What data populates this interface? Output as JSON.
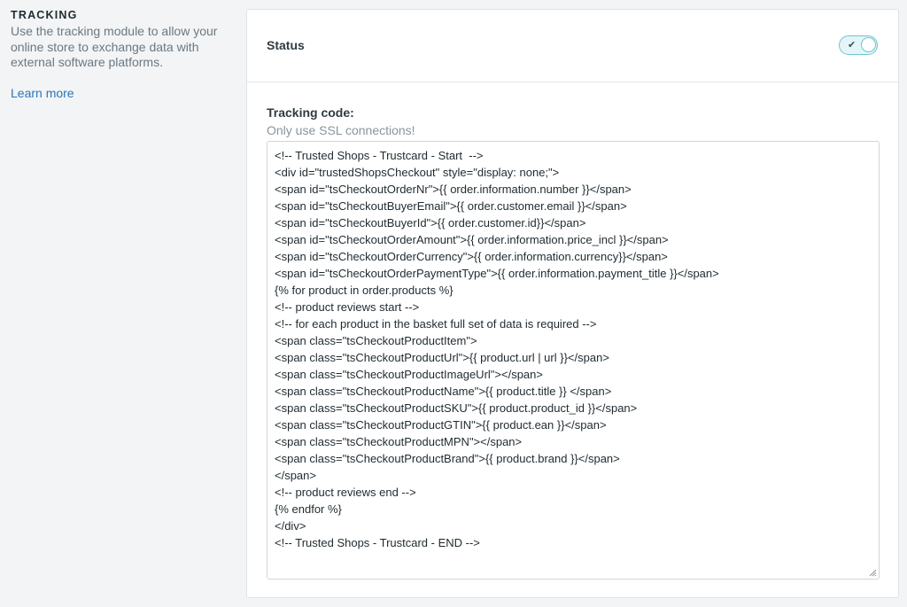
{
  "sidebar": {
    "title": "TRACKING",
    "description": "Use the tracking module to allow your online store to exchange data with external software platforms.",
    "learn_more": "Learn more"
  },
  "status": {
    "label": "Status",
    "toggle_on": true,
    "toggle_icon": "check-icon",
    "accent_color": "#6dc6d3"
  },
  "tracking": {
    "label": "Tracking code:",
    "hint": "Only use SSL connections!",
    "code": "<!-- Trusted Shops - Trustcard - Start  -->\n<div id=\"trustedShopsCheckout\" style=\"display: none;\">\n<span id=\"tsCheckoutOrderNr\">{{ order.information.number }}</span>\n<span id=\"tsCheckoutBuyerEmail\">{{ order.customer.email }}</span>\n<span id=\"tsCheckoutBuyerId\">{{ order.customer.id}}</span>\n<span id=\"tsCheckoutOrderAmount\">{{ order.information.price_incl }}</span>\n<span id=\"tsCheckoutOrderCurrency\">{{ order.information.currency}}</span>\n<span id=\"tsCheckoutOrderPaymentType\">{{ order.information.payment_title }}</span>\n{% for product in order.products %}\n<!-- product reviews start -->\n<!-- for each product in the basket full set of data is required -->\n<span class=\"tsCheckoutProductItem\">\n<span class=\"tsCheckoutProductUrl\">{{ product.url | url }}</span>\n<span class=\"tsCheckoutProductImageUrl\"></span>\n<span class=\"tsCheckoutProductName\">{{ product.title }} </span>\n<span class=\"tsCheckoutProductSKU\">{{ product.product_id }}</span>\n<span class=\"tsCheckoutProductGTIN\">{{ product.ean }}</span>\n<span class=\"tsCheckoutProductMPN\"></span>\n<span class=\"tsCheckoutProductBrand\">{{ product.brand }}</span>\n</span>\n<!-- product reviews end -->\n{% endfor %}\n</div>\n<!-- Trusted Shops - Trustcard - END -->"
  }
}
